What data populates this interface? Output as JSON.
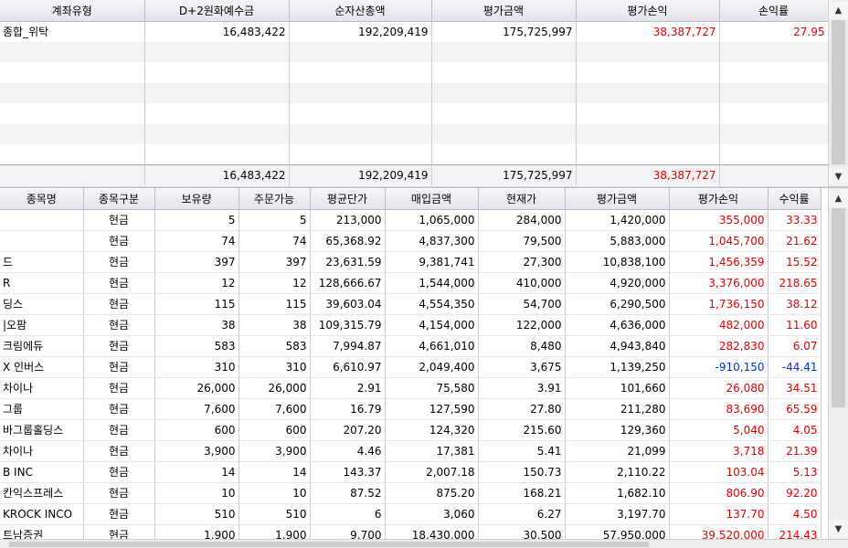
{
  "account_table": {
    "headers": [
      "계좌유형",
      "D+2원화예수금",
      "순자산총액",
      "평가금액",
      "평가손익",
      "손익률"
    ],
    "rows": [
      {
        "type": "종합_위탁",
        "deposit": "16,483,422",
        "net_assets": "192,209,419",
        "eval_amount": "175,725,997",
        "eval_pl": "38,387,727",
        "pl_rate": "27.95"
      }
    ],
    "summary": {
      "deposit": "16,483,422",
      "net_assets": "192,209,419",
      "eval_amount": "175,725,997",
      "eval_pl": "38,387,727"
    }
  },
  "holdings_table": {
    "headers": [
      "종목명",
      "종목구분",
      "보유량",
      "주문가능",
      "평균단가",
      "매입금액",
      "현재가",
      "평가금액",
      "평가손익",
      "수익률"
    ],
    "rows": [
      {
        "name": "",
        "kind": "현금",
        "qty": "5",
        "avail": "5",
        "avg": "213,000",
        "buy": "1,065,000",
        "price": "284,000",
        "eval": "1,420,000",
        "pl": "355,000",
        "rate": "33.33",
        "sign": "pos"
      },
      {
        "name": "",
        "kind": "현금",
        "qty": "74",
        "avail": "74",
        "avg": "65,368.92",
        "buy": "4,837,300",
        "price": "79,500",
        "eval": "5,883,000",
        "pl": "1,045,700",
        "rate": "21.62",
        "sign": "pos"
      },
      {
        "name": "드",
        "kind": "현금",
        "qty": "397",
        "avail": "397",
        "avg": "23,631.59",
        "buy": "9,381,741",
        "price": "27,300",
        "eval": "10,838,100",
        "pl": "1,456,359",
        "rate": "15.52",
        "sign": "pos"
      },
      {
        "name": "R",
        "kind": "현금",
        "qty": "12",
        "avail": "12",
        "avg": "128,666.67",
        "buy": "1,544,000",
        "price": "410,000",
        "eval": "4,920,000",
        "pl": "3,376,000",
        "rate": "218.65",
        "sign": "pos"
      },
      {
        "name": "딩스",
        "kind": "현금",
        "qty": "115",
        "avail": "115",
        "avg": "39,603.04",
        "buy": "4,554,350",
        "price": "54,700",
        "eval": "6,290,500",
        "pl": "1,736,150",
        "rate": "38.12",
        "sign": "pos"
      },
      {
        "name": "|오팜",
        "kind": "현금",
        "qty": "38",
        "avail": "38",
        "avg": "109,315.79",
        "buy": "4,154,000",
        "price": "122,000",
        "eval": "4,636,000",
        "pl": "482,000",
        "rate": "11.60",
        "sign": "pos"
      },
      {
        "name": "크림에듀",
        "kind": "현금",
        "qty": "583",
        "avail": "583",
        "avg": "7,994.87",
        "buy": "4,661,010",
        "price": "8,480",
        "eval": "4,943,840",
        "pl": "282,830",
        "rate": "6.07",
        "sign": "pos"
      },
      {
        "name": "X 인버스",
        "kind": "현금",
        "qty": "310",
        "avail": "310",
        "avg": "6,610.97",
        "buy": "2,049,400",
        "price": "3,675",
        "eval": "1,139,250",
        "pl": "-910,150",
        "rate": "-44.41",
        "sign": "neg"
      },
      {
        "name": "차이나",
        "kind": "현금",
        "qty": "26,000",
        "avail": "26,000",
        "avg": "2.91",
        "buy": "75,580",
        "price": "3.91",
        "eval": "101,660",
        "pl": "26,080",
        "rate": "34.51",
        "sign": "pos"
      },
      {
        "name": "그룹",
        "kind": "현금",
        "qty": "7,600",
        "avail": "7,600",
        "avg": "16.79",
        "buy": "127,590",
        "price": "27.80",
        "eval": "211,280",
        "pl": "83,690",
        "rate": "65.59",
        "sign": "pos"
      },
      {
        "name": "바그룹홀딩스",
        "kind": "현금",
        "qty": "600",
        "avail": "600",
        "avg": "207.20",
        "buy": "124,320",
        "price": "215.60",
        "eval": "129,360",
        "pl": "5,040",
        "rate": "4.05",
        "sign": "pos"
      },
      {
        "name": "차이나",
        "kind": "현금",
        "qty": "3,900",
        "avail": "3,900",
        "avg": "4.46",
        "buy": "17,381",
        "price": "5.41",
        "eval": "21,099",
        "pl": "3,718",
        "rate": "21.39",
        "sign": "pos"
      },
      {
        "name": "B INC",
        "kind": "현금",
        "qty": "14",
        "avail": "14",
        "avg": "143.37",
        "buy": "2,007.18",
        "price": "150.73",
        "eval": "2,110.22",
        "pl": "103.04",
        "rate": "5.13",
        "sign": "pos"
      },
      {
        "name": "칸익스프레스",
        "kind": "현금",
        "qty": "10",
        "avail": "10",
        "avg": "87.52",
        "buy": "875.20",
        "price": "168.21",
        "eval": "1,682.10",
        "pl": "806.90",
        "rate": "92.20",
        "sign": "pos"
      },
      {
        "name": "KROCK INCO",
        "kind": "현금",
        "qty": "510",
        "avail": "510",
        "avg": "6",
        "buy": "3,060",
        "price": "6.27",
        "eval": "3,197.70",
        "pl": "137.70",
        "rate": "4.50",
        "sign": "pos"
      },
      {
        "name": "트남증권",
        "kind": "현금",
        "qty": "1,900",
        "avail": "1,900",
        "avg": "9,700",
        "buy": "18,430,000",
        "price": "30,500",
        "eval": "57,950,000",
        "pl": "39,520,000",
        "rate": "214.43",
        "sign": "pos"
      }
    ]
  },
  "scrollbar": {
    "up_icon": "▲",
    "down_icon": "▼"
  },
  "colors": {
    "positive": "#e00000",
    "negative": "#0033cc"
  }
}
